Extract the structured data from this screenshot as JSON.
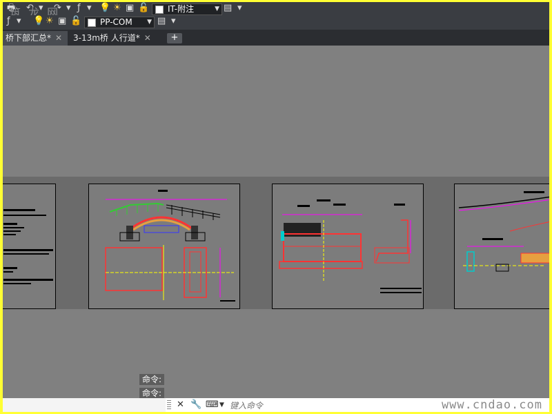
{
  "toolbar1": {
    "layer_name": "IT-附注",
    "watermark_text": "筑 龙 网"
  },
  "toolbar2": {
    "style_name": "PP-COM"
  },
  "tabs": [
    {
      "label": "桥下部汇总*"
    },
    {
      "label": "3-13m桥  人行道*"
    }
  ],
  "add_tab_label": "+",
  "command_history": [
    "命令:",
    "命令:"
  ],
  "command_input": {
    "placeholder": "键入命令"
  },
  "watermark": "www.cndao.com",
  "colors": {
    "frame_border": "#ffff33",
    "canvas": "#808080",
    "toolbar": "#3a3d42",
    "tabbar": "#2b2d31"
  }
}
